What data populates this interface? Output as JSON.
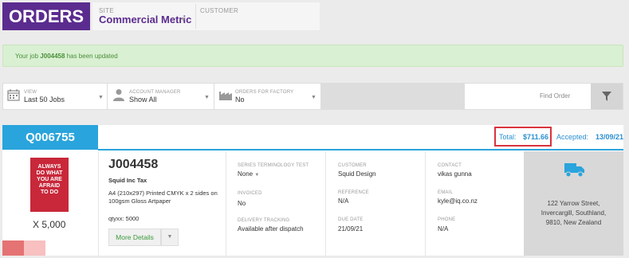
{
  "header": {
    "title": "ORDERS",
    "site_label": "SITE",
    "site_value": "Commercial Metric",
    "customer_label": "CUSTOMER"
  },
  "banner": {
    "prefix": "Your job ",
    "job": "J004458",
    "suffix": " has been updated"
  },
  "filters": {
    "view_label": "VIEW",
    "view_value": "Last 50 Jobs",
    "manager_label": "ACCOUNT MANAGER",
    "manager_value": "Show All",
    "factory_label": "ORDERS FOR FACTORY",
    "factory_value": "No",
    "find_order": "Find Order"
  },
  "quote": {
    "number": "Q006755",
    "total_label": "Total:",
    "total_value": "$711.66",
    "accepted_label": "Accepted:",
    "accepted_value": "13/09/21"
  },
  "job": {
    "number": "J004458",
    "customer_name": "Squid Inc Tax",
    "description": "A4 (210x297)  Printed CMYK x 2 sides on 100gsm Gloss Artpaper",
    "qty_line": "qtyxx: 5000",
    "quantity_display": "X 5,000",
    "product_text": [
      "ALWAYS",
      "DO WHAT",
      "YOU ARE",
      "AFRAID",
      "TO DO"
    ],
    "more_details": "More Details"
  },
  "details": {
    "series_label": "SERIES TERMINOLOGY TEST",
    "series_value": "None",
    "invoiced_label": "INVOICED",
    "invoiced_value": "No",
    "tracking_label": "DELIVERY TRACKING",
    "tracking_value": "Available after dispatch",
    "customer_label": "CUSTOMER",
    "customer_value": "Squid Design",
    "reference_label": "REFERENCE",
    "reference_value": "N/A",
    "due_label": "DUE DATE",
    "due_value": "21/09/21",
    "contact_label": "CONTACT",
    "contact_value": "vikas gunna",
    "email_label": "EMAIL",
    "email_value": "kyle@iq.co.nz",
    "phone_label": "PHONE",
    "phone_value": "N/A"
  },
  "address": {
    "line1": "122 Yarrow Street,",
    "line2": "Invercargill, Southland,",
    "line3": "9810, New Zealand"
  },
  "icons": {
    "calendar": "calendar-icon",
    "person": "person-icon",
    "factory": "factory-icon",
    "filter": "filter-icon",
    "truck": "truck-icon"
  },
  "colors": {
    "brand_purple": "#5b2c8f",
    "accent_blue": "#2aa4dc",
    "success_green": "#d9f0d2",
    "highlight_red": "#d9333c"
  }
}
